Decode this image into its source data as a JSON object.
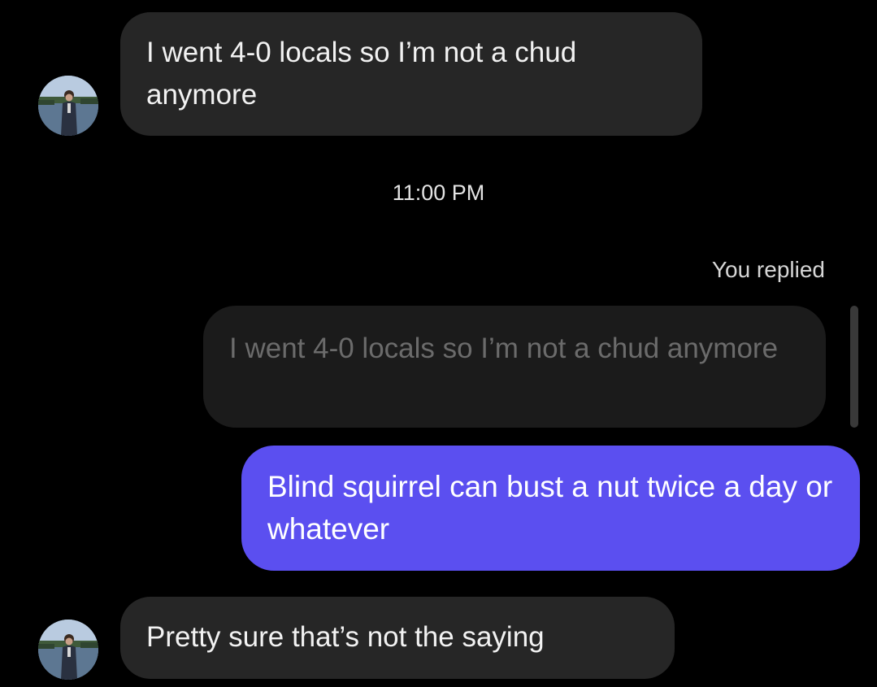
{
  "conversation": {
    "messages": [
      {
        "sender": "other",
        "text": "I went 4-0 locals so I’m not a chud anymore",
        "avatar_icon": "profile-photo-icon"
      },
      {
        "sender": "me",
        "reply_label": "You replied",
        "quoted_text": "I went 4-0 locals so I’m not a chud anymore",
        "text": "Blind squirrel can bust a nut twice a day or whatever"
      },
      {
        "sender": "other",
        "text": "Pretty sure that’s not the saying",
        "avatar_icon": "profile-photo-icon"
      }
    ],
    "timestamp": "11:00 PM"
  },
  "colors": {
    "background": "#000000",
    "incoming_bubble": "#262626",
    "outgoing_bubble": "#5b4ff0",
    "quoted_bubble": "#1b1b1b",
    "quoted_text": "#6b6b6b"
  }
}
